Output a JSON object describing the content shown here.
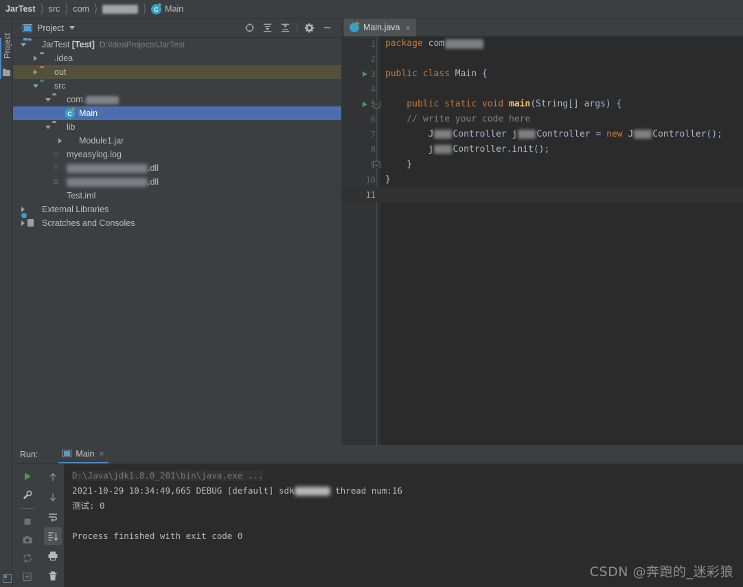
{
  "navbar": {
    "crumbs": [
      {
        "label": "JarTest",
        "bold": true,
        "redacted": false
      },
      {
        "label": "src",
        "bold": false,
        "redacted": false
      },
      {
        "label": "com",
        "bold": false,
        "redacted": false
      },
      {
        "label": "",
        "bold": false,
        "redacted": true
      },
      {
        "label": "Main",
        "bold": false,
        "redacted": false,
        "icon": "java-class-icon"
      }
    ]
  },
  "left_strip": {
    "tab_label": "Project",
    "folder_icon": "folder-icon",
    "bottom_icon": "terminal-icon"
  },
  "project_panel": {
    "title": "Project",
    "icon": "project-view-icon",
    "caret": "chevron-down-icon",
    "toolbar": [
      {
        "name": "select-opened-file-icon",
        "tooltip": "Select Opened File"
      },
      {
        "name": "expand-all-icon",
        "tooltip": "Expand All"
      },
      {
        "name": "collapse-all-icon",
        "tooltip": "Collapse All"
      },
      {
        "name": "settings-gear-icon",
        "tooltip": "Settings"
      },
      {
        "name": "hide-icon",
        "tooltip": "Hide"
      }
    ],
    "tree": [
      {
        "depth": 0,
        "arrow": "down",
        "icon": "project-root-icon",
        "label": "JarTest",
        "bold_suffix": "[Test]",
        "path": "D:\\IdeaProjects\\JarTest",
        "state": "normal"
      },
      {
        "depth": 1,
        "arrow": "right",
        "icon": "folder-gray-icon",
        "label": ".idea",
        "state": "normal"
      },
      {
        "depth": 1,
        "arrow": "right",
        "icon": "folder-orange-icon",
        "label": "out",
        "state": "highlight"
      },
      {
        "depth": 1,
        "arrow": "down",
        "icon": "folder-source-icon",
        "label": "src",
        "state": "normal"
      },
      {
        "depth": 2,
        "arrow": "down",
        "icon": "package-icon",
        "label": "com.",
        "redacted": true,
        "state": "normal"
      },
      {
        "depth": 3,
        "arrow": "none",
        "icon": "java-class-icon",
        "label": "Main",
        "state": "selected"
      },
      {
        "depth": 2,
        "arrow": "down",
        "icon": "package-icon",
        "label": "lib",
        "state": "normal"
      },
      {
        "depth": 3,
        "arrow": "right",
        "icon": "jar-icon",
        "label": "Module1.jar",
        "state": "normal"
      },
      {
        "depth": 2,
        "arrow": "none",
        "icon": "file-icon",
        "label": "myeasylog.log",
        "state": "normal"
      },
      {
        "depth": 2,
        "arrow": "none",
        "icon": "file-dll-icon",
        "label": ".dll",
        "redacted_full": true,
        "state": "normal"
      },
      {
        "depth": 2,
        "arrow": "none",
        "icon": "file-dll-icon",
        "label": ".dll",
        "redacted_full": true,
        "state": "normal"
      },
      {
        "depth": 2,
        "arrow": "none",
        "icon": "file-iml-icon",
        "label": "Test.iml",
        "state": "normal"
      },
      {
        "depth": 0,
        "arrow": "right",
        "icon": "external-libraries-icon",
        "label": "External Libraries",
        "state": "normal"
      },
      {
        "depth": 0,
        "arrow": "right",
        "icon": "scratches-icon",
        "label": "Scratches and Consoles",
        "state": "normal"
      }
    ]
  },
  "editor": {
    "tabs": [
      {
        "label": "Main.java",
        "icon": "java-class-icon",
        "close": "×",
        "active": true
      }
    ],
    "gutter": {
      "line_numbers": [
        "1",
        "2",
        "3",
        "4",
        "5",
        "6",
        "7",
        "8",
        "9",
        "10",
        "11"
      ],
      "current_line": 11,
      "run_markers": [
        3,
        5
      ],
      "fold_open_line": 5,
      "fold_close_line": 9
    },
    "code_lines": [
      {
        "n": 1,
        "tokens": [
          {
            "t": "package ",
            "c": "kw"
          },
          {
            "t": "com",
            "c": "id"
          },
          {
            "t": "",
            "c": "blur-pkg"
          }
        ]
      },
      {
        "n": 2,
        "tokens": []
      },
      {
        "n": 3,
        "tokens": [
          {
            "t": "public class ",
            "c": "kw"
          },
          {
            "t": "Main",
            "c": "id"
          },
          {
            "t": " {",
            "c": "punc"
          }
        ]
      },
      {
        "n": 4,
        "tokens": []
      },
      {
        "n": 5,
        "tokens": [
          {
            "t": "    public static void ",
            "c": "kw"
          },
          {
            "t": "main",
            "c": "fn"
          },
          {
            "t": "(String[] args) {",
            "c": "id"
          }
        ]
      },
      {
        "n": 6,
        "tokens": [
          {
            "t": "    // write your code here",
            "c": "cmt"
          }
        ]
      },
      {
        "n": 7,
        "tokens": [
          {
            "t": "        J",
            "c": "id"
          },
          {
            "t": "",
            "c": "blur-sm"
          },
          {
            "t": "Controller j",
            "c": "id"
          },
          {
            "t": "",
            "c": "blur-sm"
          },
          {
            "t": "Controller = ",
            "c": "id"
          },
          {
            "t": "new ",
            "c": "kw"
          },
          {
            "t": "J",
            "c": "id"
          },
          {
            "t": "",
            "c": "blur-sm"
          },
          {
            "t": "Controller();",
            "c": "id"
          }
        ]
      },
      {
        "n": 8,
        "tokens": [
          {
            "t": "        j",
            "c": "id"
          },
          {
            "t": "",
            "c": "blur-sm"
          },
          {
            "t": "Controller.init();",
            "c": "id"
          }
        ]
      },
      {
        "n": 9,
        "tokens": [
          {
            "t": "    }",
            "c": "punc"
          }
        ]
      },
      {
        "n": 10,
        "tokens": [
          {
            "t": "}",
            "c": "punc"
          }
        ]
      },
      {
        "n": 11,
        "tokens": []
      }
    ]
  },
  "run_panel": {
    "label": "Run:",
    "tab": {
      "label": "Main",
      "icon": "run-config-icon",
      "close": "×"
    },
    "toolbar_left": [
      {
        "name": "rerun-icon",
        "tooltip": "Rerun"
      },
      {
        "name": "wrench-settings-icon",
        "tooltip": "Edit Configuration"
      },
      {
        "name": "stop-icon",
        "tooltip": "Stop"
      },
      {
        "name": "camera-dump-icon",
        "tooltip": "Dump Threads"
      },
      {
        "name": "restart-icon",
        "tooltip": "Restart"
      },
      {
        "name": "pin-tab-icon",
        "tooltip": "Pin Tab"
      }
    ],
    "toolbar_right": [
      {
        "name": "arrow-up-icon",
        "tooltip": "Up"
      },
      {
        "name": "arrow-down-icon",
        "tooltip": "Down"
      },
      {
        "name": "soft-wrap-icon",
        "tooltip": "Use Soft Wraps"
      },
      {
        "name": "scroll-to-end-icon",
        "tooltip": "Scroll to End",
        "active": true
      },
      {
        "name": "print-icon",
        "tooltip": "Print"
      },
      {
        "name": "trash-icon",
        "tooltip": "Clear All"
      }
    ],
    "console_lines": [
      {
        "text": "D:\\Java\\jdk1.8.0_201\\bin\\java.exe ...",
        "style": "dim"
      },
      {
        "text": "2021-10-29 10:34:49,665 DEBUG [default] sdk",
        "suffix": " thread num:16",
        "redacted": true,
        "style": "normal"
      },
      {
        "text": "测试: 0",
        "style": "normal"
      },
      {
        "text": "",
        "style": "normal"
      },
      {
        "text": "Process finished with exit code 0",
        "style": "normal"
      }
    ]
  },
  "watermark": {
    "text": "CSDN @奔跑的_迷彩狼"
  },
  "colors": {
    "panel_bg": "#3c3f41",
    "editor_bg": "#2b2b2b",
    "gutter_bg": "#313335",
    "selection_blue": "#4b6eaf",
    "highlight_olive": "#53503c",
    "accent_blue": "#4a88c7",
    "keyword_orange": "#cc7832",
    "identifier": "#a9b7c6",
    "method_yellow": "#ffc66d",
    "comment_gray": "#808080",
    "run_green": "#499c54"
  }
}
